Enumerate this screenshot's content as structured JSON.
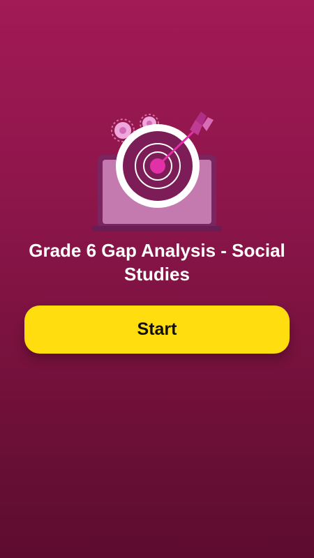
{
  "quiz": {
    "title": "Grade 6 Gap Analysis - Social Studies",
    "start_label": "Start"
  },
  "illustration": {
    "icons": [
      "laptop-icon",
      "gear-icon",
      "target-icon",
      "arrow-icon"
    ]
  },
  "colors": {
    "background_top": "#a21a56",
    "background_bottom": "#5c0c2e",
    "button": "#ffdd0f",
    "button_text": "#111111",
    "title_text": "#ffffff"
  }
}
